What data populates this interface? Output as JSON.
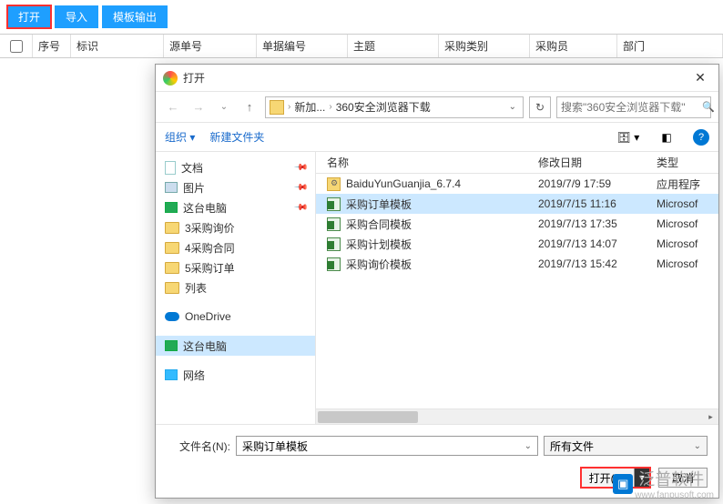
{
  "toolbar": {
    "open": "打开",
    "import": "导入",
    "template_export": "模板输出"
  },
  "grid": {
    "cols": [
      "序号",
      "标识",
      "源单号",
      "单据编号",
      "主题",
      "采购类别",
      "采购员",
      "部门"
    ]
  },
  "dialog": {
    "title": "打开",
    "nav": {
      "path_segment1": "新加...",
      "path_segment2": "360安全浏览器下载",
      "search_placeholder": "搜索\"360安全浏览器下载\""
    },
    "cmdbar": {
      "organize": "组织",
      "new_folder": "新建文件夹"
    },
    "tree": [
      {
        "icon": "doc",
        "label": "文档",
        "pinned": true
      },
      {
        "icon": "img",
        "label": "图片",
        "pinned": true
      },
      {
        "icon": "pc",
        "label": "这台电脑",
        "pinned": true
      },
      {
        "icon": "folder",
        "label": "3采购询价"
      },
      {
        "icon": "folder",
        "label": "4采购合同"
      },
      {
        "icon": "folder",
        "label": "5采购订单"
      },
      {
        "icon": "folder",
        "label": "列表"
      },
      {
        "icon": "cloud",
        "label": "OneDrive",
        "spaced": true
      },
      {
        "icon": "pc",
        "label": "这台电脑",
        "selected": true,
        "spaced": true
      },
      {
        "icon": "net",
        "label": "网络",
        "spaced": true
      }
    ],
    "columns": {
      "name": "名称",
      "modified": "修改日期",
      "type": "类型"
    },
    "files": [
      {
        "icon": "app",
        "name": "BaiduYunGuanjia_6.7.4",
        "date": "2019/7/9 17:59",
        "type": "应用程序"
      },
      {
        "icon": "xls",
        "name": "采购订单模板",
        "date": "2019/7/15 11:16",
        "type": "Microsof",
        "selected": true
      },
      {
        "icon": "xls",
        "name": "采购合同模板",
        "date": "2019/7/13 17:35",
        "type": "Microsof"
      },
      {
        "icon": "xls",
        "name": "采购计划模板",
        "date": "2019/7/13 14:07",
        "type": "Microsof"
      },
      {
        "icon": "xls",
        "name": "采购询价模板",
        "date": "2019/7/13 15:42",
        "type": "Microsof"
      }
    ],
    "footer": {
      "filename_label": "文件名(N):",
      "filename_value": "采购订单模板",
      "filter": "所有文件",
      "open_btn": "打开(O)",
      "cancel_btn": "取消"
    }
  },
  "watermark": {
    "brand": "泛普软件",
    "url": "www.fanpusoft.com"
  }
}
